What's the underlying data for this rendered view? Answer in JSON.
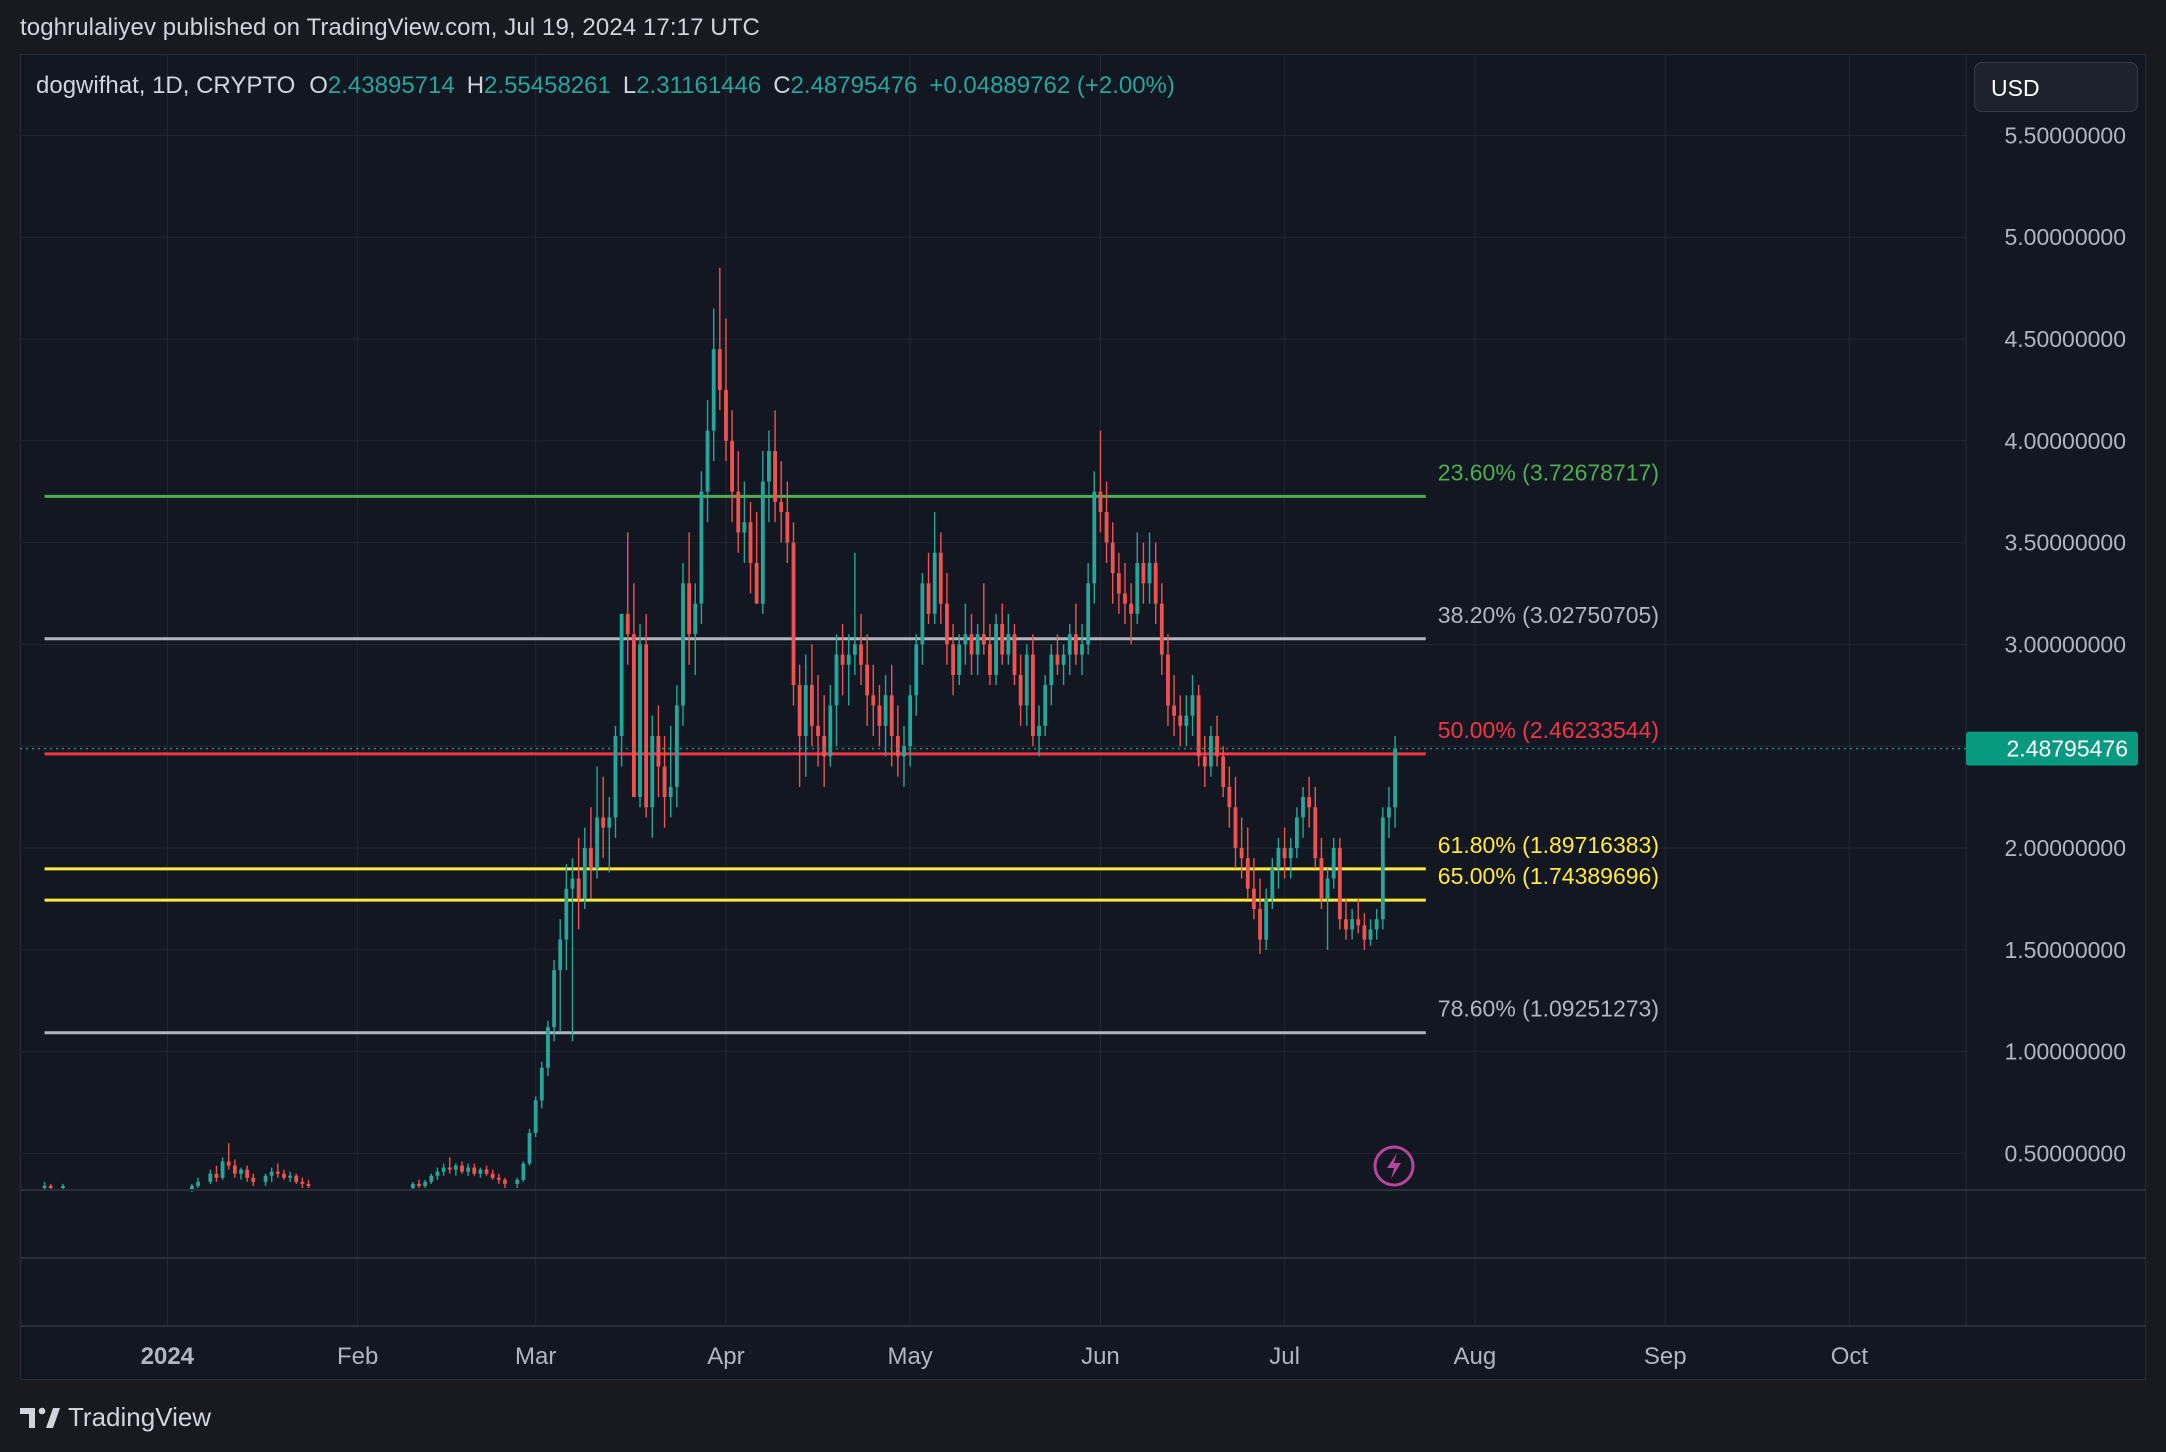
{
  "header": {
    "published_text": "toghrulaliyev published on TradingView.com, Jul 19, 2024 17:17 UTC"
  },
  "symbol": {
    "name": "dogwifhat, 1D, CRYPTO",
    "open_label": "O",
    "open": "2.43895714",
    "high_label": "H",
    "high": "2.55458261",
    "low_label": "L",
    "low": "2.31161446",
    "close_label": "C",
    "close": "2.48795476",
    "change": "+0.04889762 (+2.00%)"
  },
  "currency_button": {
    "label": "USD"
  },
  "footer": {
    "logo_text": "TradingView"
  },
  "colors": {
    "background": "#131722",
    "up": "#26a69a",
    "down": "#ef5350",
    "fib_green": "#4caf50",
    "fib_gray": "#b2b5be",
    "fib_red": "#f23645",
    "fib_yellow": "#ffeb3b",
    "price_tag": "#089981"
  },
  "chart_data": {
    "type": "candlestick",
    "title": "",
    "interval": "1D",
    "ylim": [
      0.32,
      5.9
    ],
    "y_ticks": [
      "0.50000000",
      "1.00000000",
      "1.50000000",
      "2.00000000",
      "2.50000000",
      "3.00000000",
      "3.50000000",
      "4.00000000",
      "4.50000000",
      "5.00000000",
      "5.50000000"
    ],
    "y_tick_values": [
      0.5,
      1.0,
      1.5,
      2.0,
      2.5,
      3.0,
      3.5,
      4.0,
      4.5,
      5.0,
      5.5
    ],
    "x_ticks": [
      "2024",
      "Feb",
      "Mar",
      "Apr",
      "May",
      "Jun",
      "Jul",
      "Aug",
      "Sep",
      "Oct"
    ],
    "x_tick_dates": [
      "2024-01-01",
      "2024-02-01",
      "2024-03-01",
      "2024-04-01",
      "2024-05-01",
      "2024-06-01",
      "2024-07-01",
      "2024-08-01",
      "2024-09-01",
      "2024-10-01"
    ],
    "x_range": [
      "2023-12-08",
      "2024-10-20"
    ],
    "last_price": "2.48795476",
    "last_price_value": 2.48795476,
    "fib_levels": [
      {
        "label": "23.60% (3.72678717)",
        "value": 3.72678717,
        "color": "#4caf50"
      },
      {
        "label": "38.20% (3.02750705)",
        "value": 3.02750705,
        "color": "#b2b5be"
      },
      {
        "label": "50.00% (2.46233544)",
        "value": 2.46233544,
        "color": "#f23645"
      },
      {
        "label": "61.80% (1.89716383)",
        "value": 1.89716383,
        "color": "#ffeb3b"
      },
      {
        "label": "65.00% (1.74389696)",
        "value": 1.74389696,
        "color": "#ffeb3b"
      },
      {
        "label": "78.60% (1.09251273)",
        "value": 1.09251273,
        "color": "#b2b5be"
      }
    ],
    "fib_start": "2023-12-12",
    "fib_end": "2024-07-24",
    "candles": [
      [
        "2023-12-12",
        0.33,
        0.36,
        0.32,
        0.34
      ],
      [
        "2023-12-13",
        0.34,
        0.35,
        0.32,
        0.33
      ],
      [
        "2023-12-15",
        0.33,
        0.35,
        0.32,
        0.34
      ],
      [
        "2024-01-05",
        0.32,
        0.35,
        0.31,
        0.34
      ],
      [
        "2024-01-06",
        0.34,
        0.38,
        0.33,
        0.36
      ],
      [
        "2024-01-08",
        0.36,
        0.42,
        0.35,
        0.4
      ],
      [
        "2024-01-09",
        0.4,
        0.44,
        0.36,
        0.38
      ],
      [
        "2024-01-10",
        0.38,
        0.48,
        0.37,
        0.46
      ],
      [
        "2024-01-11",
        0.46,
        0.55,
        0.42,
        0.44
      ],
      [
        "2024-01-12",
        0.44,
        0.47,
        0.38,
        0.4
      ],
      [
        "2024-01-13",
        0.4,
        0.43,
        0.37,
        0.42
      ],
      [
        "2024-01-14",
        0.42,
        0.44,
        0.36,
        0.38
      ],
      [
        "2024-01-15",
        0.38,
        0.4,
        0.34,
        0.36
      ],
      [
        "2024-01-17",
        0.36,
        0.4,
        0.34,
        0.39
      ],
      [
        "2024-01-18",
        0.39,
        0.43,
        0.36,
        0.41
      ],
      [
        "2024-01-19",
        0.41,
        0.45,
        0.38,
        0.4
      ],
      [
        "2024-01-20",
        0.4,
        0.42,
        0.37,
        0.38
      ],
      [
        "2024-01-21",
        0.38,
        0.41,
        0.36,
        0.39
      ],
      [
        "2024-01-22",
        0.39,
        0.4,
        0.35,
        0.36
      ],
      [
        "2024-01-23",
        0.36,
        0.38,
        0.33,
        0.35
      ],
      [
        "2024-01-24",
        0.35,
        0.37,
        0.33,
        0.34
      ],
      [
        "2024-02-10",
        0.33,
        0.36,
        0.32,
        0.35
      ],
      [
        "2024-02-11",
        0.35,
        0.37,
        0.33,
        0.34
      ],
      [
        "2024-02-12",
        0.34,
        0.37,
        0.33,
        0.36
      ],
      [
        "2024-02-13",
        0.36,
        0.4,
        0.35,
        0.39
      ],
      [
        "2024-02-14",
        0.39,
        0.43,
        0.37,
        0.41
      ],
      [
        "2024-02-15",
        0.41,
        0.45,
        0.39,
        0.43
      ],
      [
        "2024-02-16",
        0.43,
        0.48,
        0.4,
        0.42
      ],
      [
        "2024-02-17",
        0.42,
        0.45,
        0.39,
        0.44
      ],
      [
        "2024-02-18",
        0.44,
        0.46,
        0.4,
        0.41
      ],
      [
        "2024-02-19",
        0.41,
        0.45,
        0.39,
        0.43
      ],
      [
        "2024-02-20",
        0.43,
        0.45,
        0.39,
        0.4
      ],
      [
        "2024-02-21",
        0.4,
        0.43,
        0.38,
        0.42
      ],
      [
        "2024-02-22",
        0.42,
        0.44,
        0.39,
        0.4
      ],
      [
        "2024-02-23",
        0.4,
        0.42,
        0.37,
        0.38
      ],
      [
        "2024-02-24",
        0.38,
        0.4,
        0.35,
        0.37
      ],
      [
        "2024-02-25",
        0.37,
        0.38,
        0.33,
        0.35
      ],
      [
        "2024-02-27",
        0.35,
        0.38,
        0.33,
        0.37
      ],
      [
        "2024-02-28",
        0.37,
        0.46,
        0.36,
        0.45
      ],
      [
        "2024-02-29",
        0.45,
        0.62,
        0.44,
        0.6
      ],
      [
        "2024-03-01",
        0.6,
        0.78,
        0.58,
        0.76
      ],
      [
        "2024-03-02",
        0.76,
        0.95,
        0.72,
        0.92
      ],
      [
        "2024-03-03",
        0.92,
        1.15,
        0.88,
        1.12
      ],
      [
        "2024-03-04",
        1.12,
        1.45,
        1.05,
        1.4
      ],
      [
        "2024-03-05",
        1.4,
        1.65,
        1.1,
        1.55
      ],
      [
        "2024-03-06",
        1.55,
        1.92,
        1.4,
        1.8
      ],
      [
        "2024-03-07",
        1.8,
        1.95,
        1.05,
        1.85
      ],
      [
        "2024-03-08",
        1.85,
        2.05,
        1.6,
        1.75
      ],
      [
        "2024-03-09",
        1.75,
        2.1,
        1.7,
        2.0
      ],
      [
        "2024-03-10",
        2.0,
        2.2,
        1.75,
        1.9
      ],
      [
        "2024-03-11",
        1.9,
        2.4,
        1.85,
        2.15
      ],
      [
        "2024-03-12",
        2.15,
        2.35,
        1.95,
        2.1
      ],
      [
        "2024-03-13",
        2.1,
        2.25,
        1.88,
        2.15
      ],
      [
        "2024-03-14",
        2.15,
        2.6,
        2.05,
        2.55
      ],
      [
        "2024-03-15",
        2.55,
        3.15,
        2.4,
        3.15
      ],
      [
        "2024-03-16",
        3.15,
        3.55,
        2.9,
        3.05
      ],
      [
        "2024-03-17",
        3.05,
        3.3,
        2.45,
        2.25
      ],
      [
        "2024-03-18",
        2.25,
        3.1,
        2.2,
        3.0
      ],
      [
        "2024-03-19",
        3.0,
        3.15,
        2.15,
        2.2
      ],
      [
        "2024-03-20",
        2.2,
        2.65,
        2.05,
        2.55
      ],
      [
        "2024-03-21",
        2.55,
        2.7,
        2.25,
        2.4
      ],
      [
        "2024-03-22",
        2.4,
        2.55,
        2.1,
        2.25
      ],
      [
        "2024-03-23",
        2.25,
        2.6,
        2.15,
        2.3
      ],
      [
        "2024-03-24",
        2.3,
        2.8,
        2.2,
        2.7
      ],
      [
        "2024-03-25",
        2.7,
        3.4,
        2.6,
        3.3
      ],
      [
        "2024-03-26",
        3.3,
        3.55,
        2.9,
        3.05
      ],
      [
        "2024-03-27",
        3.05,
        3.3,
        2.85,
        3.2
      ],
      [
        "2024-03-28",
        3.2,
        3.85,
        3.1,
        3.75
      ],
      [
        "2024-03-29",
        3.75,
        4.2,
        3.6,
        4.05
      ],
      [
        "2024-03-30",
        4.05,
        4.65,
        3.9,
        4.45
      ],
      [
        "2024-03-31",
        4.45,
        4.85,
        4.15,
        4.25
      ],
      [
        "2024-04-01",
        4.25,
        4.6,
        3.9,
        4.0
      ],
      [
        "2024-04-02",
        4.0,
        4.15,
        3.6,
        3.75
      ],
      [
        "2024-04-03",
        3.75,
        3.95,
        3.45,
        3.55
      ],
      [
        "2024-04-04",
        3.55,
        3.8,
        3.4,
        3.6
      ],
      [
        "2024-04-05",
        3.6,
        3.7,
        3.25,
        3.4
      ],
      [
        "2024-04-06",
        3.4,
        3.65,
        3.2,
        3.2
      ],
      [
        "2024-04-07",
        3.2,
        3.95,
        3.15,
        3.8
      ],
      [
        "2024-04-08",
        3.8,
        4.05,
        3.6,
        3.95
      ],
      [
        "2024-04-09",
        3.95,
        4.15,
        3.6,
        3.7
      ],
      [
        "2024-04-10",
        3.7,
        3.9,
        3.5,
        3.65
      ],
      [
        "2024-04-11",
        3.65,
        3.8,
        3.4,
        3.5
      ],
      [
        "2024-04-12",
        3.5,
        3.6,
        2.7,
        2.8
      ],
      [
        "2024-04-13",
        2.8,
        2.9,
        2.3,
        2.55
      ],
      [
        "2024-04-14",
        2.55,
        2.95,
        2.35,
        2.8
      ],
      [
        "2024-04-15",
        2.8,
        3.0,
        2.5,
        2.6
      ],
      [
        "2024-04-16",
        2.6,
        2.85,
        2.4,
        2.55
      ],
      [
        "2024-04-17",
        2.55,
        2.75,
        2.3,
        2.45
      ],
      [
        "2024-04-18",
        2.45,
        2.8,
        2.4,
        2.7
      ],
      [
        "2024-04-19",
        2.7,
        3.05,
        2.5,
        2.95
      ],
      [
        "2024-04-20",
        2.95,
        3.1,
        2.75,
        2.9
      ],
      [
        "2024-04-21",
        2.9,
        3.05,
        2.7,
        2.95
      ],
      [
        "2024-04-22",
        2.95,
        3.45,
        2.85,
        3.0
      ],
      [
        "2024-04-23",
        3.0,
        3.15,
        2.8,
        2.9
      ],
      [
        "2024-04-24",
        2.9,
        3.05,
        2.6,
        2.75
      ],
      [
        "2024-04-25",
        2.75,
        2.9,
        2.55,
        2.7
      ],
      [
        "2024-04-26",
        2.7,
        2.8,
        2.5,
        2.6
      ],
      [
        "2024-04-27",
        2.6,
        2.85,
        2.45,
        2.75
      ],
      [
        "2024-04-28",
        2.75,
        2.9,
        2.4,
        2.55
      ],
      [
        "2024-04-29",
        2.55,
        2.7,
        2.35,
        2.45
      ],
      [
        "2024-04-30",
        2.45,
        2.6,
        2.3,
        2.5
      ],
      [
        "2024-05-01",
        2.5,
        2.8,
        2.4,
        2.75
      ],
      [
        "2024-05-02",
        2.75,
        3.05,
        2.65,
        3.0
      ],
      [
        "2024-05-03",
        3.0,
        3.35,
        2.9,
        3.3
      ],
      [
        "2024-05-04",
        3.3,
        3.45,
        3.1,
        3.15
      ],
      [
        "2024-05-05",
        3.15,
        3.65,
        3.1,
        3.45
      ],
      [
        "2024-05-06",
        3.45,
        3.55,
        3.1,
        3.2
      ],
      [
        "2024-05-07",
        3.2,
        3.35,
        2.9,
        3.0
      ],
      [
        "2024-05-08",
        3.0,
        3.1,
        2.75,
        2.85
      ],
      [
        "2024-05-09",
        2.85,
        3.05,
        2.8,
        3.0
      ],
      [
        "2024-05-10",
        3.0,
        3.2,
        2.9,
        3.05
      ],
      [
        "2024-05-11",
        3.05,
        3.15,
        2.85,
        2.95
      ],
      [
        "2024-05-12",
        2.95,
        3.1,
        2.85,
        3.05
      ],
      [
        "2024-05-13",
        3.05,
        3.3,
        2.95,
        3.0
      ],
      [
        "2024-05-14",
        3.0,
        3.1,
        2.8,
        2.85
      ],
      [
        "2024-05-15",
        2.85,
        3.15,
        2.8,
        3.1
      ],
      [
        "2024-05-16",
        3.1,
        3.2,
        2.9,
        2.95
      ],
      [
        "2024-05-17",
        2.95,
        3.15,
        2.9,
        3.05
      ],
      [
        "2024-05-18",
        3.05,
        3.1,
        2.8,
        2.85
      ],
      [
        "2024-05-19",
        2.85,
        2.95,
        2.6,
        2.7
      ],
      [
        "2024-05-20",
        2.7,
        3.0,
        2.6,
        2.95
      ],
      [
        "2024-05-21",
        2.95,
        3.05,
        2.5,
        2.55
      ],
      [
        "2024-05-22",
        2.55,
        2.7,
        2.45,
        2.6
      ],
      [
        "2024-05-23",
        2.6,
        2.85,
        2.55,
        2.8
      ],
      [
        "2024-05-24",
        2.8,
        3.0,
        2.7,
        2.95
      ],
      [
        "2024-05-25",
        2.95,
        3.05,
        2.85,
        2.9
      ],
      [
        "2024-05-26",
        2.9,
        3.0,
        2.8,
        2.95
      ],
      [
        "2024-05-27",
        2.95,
        3.1,
        2.85,
        3.05
      ],
      [
        "2024-05-28",
        3.05,
        3.2,
        2.9,
        2.95
      ],
      [
        "2024-05-29",
        2.95,
        3.1,
        2.85,
        3.0
      ],
      [
        "2024-05-30",
        3.0,
        3.4,
        2.95,
        3.3
      ],
      [
        "2024-05-31",
        3.3,
        3.85,
        3.2,
        3.75
      ],
      [
        "2024-06-01",
        3.75,
        4.05,
        3.55,
        3.65
      ],
      [
        "2024-06-02",
        3.65,
        3.8,
        3.4,
        3.5
      ],
      [
        "2024-06-03",
        3.5,
        3.6,
        3.2,
        3.35
      ],
      [
        "2024-06-04",
        3.35,
        3.45,
        3.15,
        3.25
      ],
      [
        "2024-06-05",
        3.25,
        3.4,
        3.1,
        3.2
      ],
      [
        "2024-06-06",
        3.2,
        3.3,
        3.0,
        3.15
      ],
      [
        "2024-06-07",
        3.15,
        3.55,
        3.1,
        3.4
      ],
      [
        "2024-06-08",
        3.4,
        3.5,
        3.2,
        3.3
      ],
      [
        "2024-06-09",
        3.3,
        3.55,
        3.2,
        3.4
      ],
      [
        "2024-06-10",
        3.4,
        3.5,
        3.1,
        3.2
      ],
      [
        "2024-06-11",
        3.2,
        3.3,
        2.85,
        2.95
      ],
      [
        "2024-06-12",
        2.95,
        3.05,
        2.6,
        2.7
      ],
      [
        "2024-06-13",
        2.7,
        2.85,
        2.55,
        2.65
      ],
      [
        "2024-06-14",
        2.65,
        2.75,
        2.5,
        2.6
      ],
      [
        "2024-06-15",
        2.6,
        2.75,
        2.5,
        2.65
      ],
      [
        "2024-06-16",
        2.65,
        2.85,
        2.55,
        2.75
      ],
      [
        "2024-06-17",
        2.75,
        2.8,
        2.4,
        2.45
      ],
      [
        "2024-06-18",
        2.45,
        2.55,
        2.3,
        2.4
      ],
      [
        "2024-06-19",
        2.4,
        2.6,
        2.35,
        2.55
      ],
      [
        "2024-06-20",
        2.55,
        2.65,
        2.4,
        2.45
      ],
      [
        "2024-06-21",
        2.45,
        2.5,
        2.25,
        2.3
      ],
      [
        "2024-06-22",
        2.3,
        2.4,
        2.1,
        2.2
      ],
      [
        "2024-06-23",
        2.2,
        2.35,
        1.9,
        2.0
      ],
      [
        "2024-06-24",
        2.0,
        2.15,
        1.85,
        1.95
      ],
      [
        "2024-06-25",
        1.95,
        2.1,
        1.75,
        1.8
      ],
      [
        "2024-06-26",
        1.8,
        1.95,
        1.65,
        1.7
      ],
      [
        "2024-06-27",
        1.7,
        1.85,
        1.48,
        1.55
      ],
      [
        "2024-06-28",
        1.55,
        1.8,
        1.5,
        1.75
      ],
      [
        "2024-06-29",
        1.75,
        1.95,
        1.7,
        1.9
      ],
      [
        "2024-06-30",
        1.9,
        2.05,
        1.8,
        2.0
      ],
      [
        "2024-07-01",
        2.0,
        2.1,
        1.85,
        1.95
      ],
      [
        "2024-07-02",
        1.95,
        2.05,
        1.85,
        2.0
      ],
      [
        "2024-07-03",
        2.0,
        2.2,
        1.95,
        2.15
      ],
      [
        "2024-07-04",
        2.15,
        2.3,
        2.05,
        2.25
      ],
      [
        "2024-07-05",
        2.25,
        2.35,
        2.1,
        2.2
      ],
      [
        "2024-07-06",
        2.2,
        2.3,
        1.9,
        1.95
      ],
      [
        "2024-07-07",
        1.95,
        2.05,
        1.7,
        1.75
      ],
      [
        "2024-07-08",
        1.75,
        1.9,
        1.5,
        1.85
      ],
      [
        "2024-07-09",
        1.85,
        2.05,
        1.8,
        2.0
      ],
      [
        "2024-07-10",
        2.0,
        2.05,
        1.6,
        1.65
      ],
      [
        "2024-07-11",
        1.65,
        1.75,
        1.55,
        1.6
      ],
      [
        "2024-07-12",
        1.6,
        1.7,
        1.55,
        1.65
      ],
      [
        "2024-07-13",
        1.65,
        1.75,
        1.58,
        1.62
      ],
      [
        "2024-07-14",
        1.62,
        1.68,
        1.5,
        1.55
      ],
      [
        "2024-07-15",
        1.55,
        1.65,
        1.52,
        1.6
      ],
      [
        "2024-07-16",
        1.6,
        1.7,
        1.55,
        1.65
      ],
      [
        "2024-07-17",
        1.65,
        2.2,
        1.6,
        2.15
      ],
      [
        "2024-07-18",
        2.15,
        2.3,
        2.05,
        2.2
      ],
      [
        "2024-07-19",
        2.2,
        2.55,
        2.1,
        2.49
      ]
    ]
  }
}
